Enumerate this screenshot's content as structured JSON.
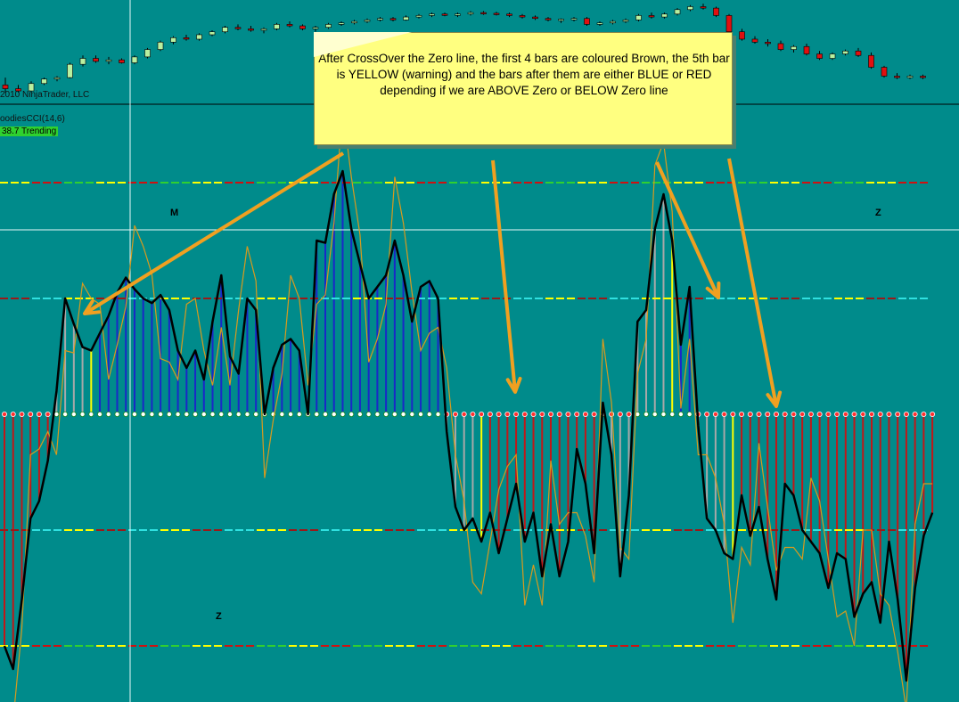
{
  "app": {
    "copyright": "2010 NinjaTrader, LLC",
    "indicator_name": "oodiesCCI(14,6)",
    "indicator_badge": "38.7 Trending"
  },
  "annotation": {
    "text": "After CrossOver the Zero line, the first 4 bars are coloured Brown, the 5th bar is YELLOW (warning) and the bars after them are either BLUE or RED depending if we are ABOVE Zero or BELOW Zero line"
  },
  "markers": {
    "m": "M",
    "z1": "Z",
    "z2": "Z"
  },
  "colors": {
    "background": "#008b8b",
    "above_zero": "#1a28c8",
    "below_zero": "#c01818",
    "warning": "#ffff00",
    "brown_grey": "#a8a8a8",
    "cci_line": "#000000",
    "turbo_line": "#d79a1e",
    "arrow": "#f0a020"
  },
  "chart_data": [
    {
      "type": "candlestick",
      "description_visible": "price candles",
      "values": [
        [
          95,
          96,
          94,
          94.5
        ],
        [
          94.5,
          95,
          94,
          94.2
        ],
        [
          94.2,
          95.5,
          94,
          95.2
        ],
        [
          95.2,
          96,
          95,
          95.8
        ],
        [
          95.8,
          96.2,
          95.5,
          96
        ],
        [
          96,
          98,
          95.9,
          97.8
        ],
        [
          97.8,
          99,
          97.5,
          98.6
        ],
        [
          98.6,
          99,
          98,
          98.2
        ],
        [
          98.2,
          98.8,
          97.8,
          98.4
        ],
        [
          98.4,
          98.6,
          97.9,
          98
        ],
        [
          98,
          99,
          97.8,
          98.8
        ],
        [
          98.8,
          100,
          98.6,
          99.8
        ],
        [
          99.8,
          101,
          99.6,
          100.8
        ],
        [
          100.8,
          101.6,
          100.5,
          101.4
        ],
        [
          101.4,
          101.8,
          101,
          101.2
        ],
        [
          101.2,
          102,
          101,
          101.8
        ],
        [
          101.8,
          102.4,
          101.6,
          102.2
        ],
        [
          102.2,
          103,
          102,
          102.8
        ],
        [
          102.8,
          103.2,
          102.4,
          102.6
        ],
        [
          102.6,
          103,
          102.2,
          102.4
        ],
        [
          102.4,
          102.8,
          102,
          102.6
        ],
        [
          102.6,
          103.4,
          102.4,
          103.2
        ],
        [
          103.2,
          103.6,
          102.8,
          103
        ],
        [
          103,
          103.2,
          102.4,
          102.6
        ],
        [
          102.6,
          103,
          102.2,
          102.8
        ],
        [
          102.8,
          103.4,
          102.6,
          103.2
        ],
        [
          103.2,
          103.6,
          103,
          103.4
        ],
        [
          103.4,
          103.8,
          103.2,
          103.6
        ],
        [
          103.6,
          104,
          103.4,
          103.8
        ],
        [
          103.8,
          104.2,
          103.6,
          104
        ],
        [
          104,
          104.2,
          103.6,
          103.8
        ],
        [
          103.8,
          104.4,
          103.7,
          104.2
        ],
        [
          104.2,
          104.6,
          104,
          104.4
        ],
        [
          104.4,
          104.8,
          104.2,
          104.6
        ],
        [
          104.6,
          104.8,
          104.3,
          104.5
        ],
        [
          104.5,
          104.8,
          104.2,
          104.6
        ],
        [
          104.6,
          105,
          104.4,
          104.8
        ],
        [
          104.8,
          105,
          104.5,
          104.7
        ],
        [
          104.7,
          104.9,
          104.4,
          104.6
        ],
        [
          104.6,
          104.8,
          104.2,
          104.4
        ],
        [
          104.4,
          104.6,
          104,
          104.2
        ],
        [
          104.2,
          104.4,
          103.8,
          104
        ],
        [
          104,
          104.2,
          103.6,
          103.8
        ],
        [
          103.8,
          104,
          103.4,
          103.9
        ],
        [
          103.9,
          104.2,
          103.6,
          104
        ],
        [
          104,
          104.2,
          103,
          103.2
        ],
        [
          103.2,
          103.6,
          103,
          103.4
        ],
        [
          103.4,
          103.8,
          103.2,
          103.6
        ],
        [
          103.6,
          104,
          103.4,
          103.8
        ],
        [
          103.8,
          104.6,
          103.6,
          104.4
        ],
        [
          104.4,
          104.8,
          104,
          104.2
        ],
        [
          104.2,
          104.8,
          104,
          104.6
        ],
        [
          104.6,
          105.4,
          104.4,
          105.2
        ],
        [
          105.2,
          105.8,
          105,
          105.6
        ],
        [
          105.6,
          106,
          105.2,
          105.4
        ],
        [
          105.4,
          105.6,
          104.2,
          104.4
        ],
        [
          104.4,
          104.6,
          102,
          102.2
        ],
        [
          102.2,
          102.6,
          101,
          101.2
        ],
        [
          101.2,
          101.6,
          100.6,
          100.8
        ],
        [
          100.8,
          101.2,
          100.2,
          100.6
        ],
        [
          100.6,
          101,
          99.6,
          99.8
        ],
        [
          99.8,
          100.4,
          99.4,
          100.2
        ],
        [
          100.2,
          100.6,
          99,
          99.2
        ],
        [
          99.2,
          99.6,
          98.4,
          98.6
        ],
        [
          98.6,
          99.4,
          98.4,
          99.2
        ],
        [
          99.2,
          99.8,
          99,
          99.6
        ],
        [
          99.6,
          100,
          98.8,
          99
        ],
        [
          99,
          99.4,
          97.2,
          97.4
        ],
        [
          97.4,
          97.6,
          96,
          96.2
        ],
        [
          96.2,
          96.6,
          95.8,
          96
        ],
        [
          96,
          96.4,
          95.8,
          96.2
        ],
        [
          96.2,
          96.4,
          95.8,
          96
        ]
      ]
    },
    {
      "type": "bar",
      "series": [
        {
          "name": "",
          "values": [
            -200,
            -220,
            -160,
            -90,
            -75,
            -40,
            20,
            100,
            78,
            58,
            55,
            70,
            85,
            105,
            118,
            108,
            100,
            96,
            103,
            90,
            55,
            40,
            55,
            30,
            80,
            120,
            50,
            35,
            100,
            90,
            0,
            40,
            60,
            65,
            55,
            0,
            150,
            148,
            190,
            210,
            160,
            130,
            100,
            110,
            120,
            150,
            120,
            80,
            110,
            115,
            100,
            -15,
            -80,
            -100,
            -90,
            -110,
            -85,
            -120,
            -90,
            -60,
            -110,
            -85,
            -140,
            -95,
            -140,
            -110,
            -30,
            -60,
            -120,
            10,
            -35,
            -140,
            -70,
            80,
            90,
            160,
            190,
            150,
            60,
            110,
            -10,
            -90,
            -100,
            -120,
            -125,
            -70,
            -105,
            -80,
            -125,
            -160,
            -60,
            -70,
            -100,
            -110,
            -120,
            -150,
            -120,
            -125,
            -175,
            -155,
            -145,
            -180,
            -110,
            -160,
            -230,
            -150,
            -105,
            -85
          ]
        }
      ],
      "ylim": [
        -230,
        265
      ],
      "grid_levels": [
        -200,
        -100,
        0,
        100,
        200
      ]
    }
  ]
}
